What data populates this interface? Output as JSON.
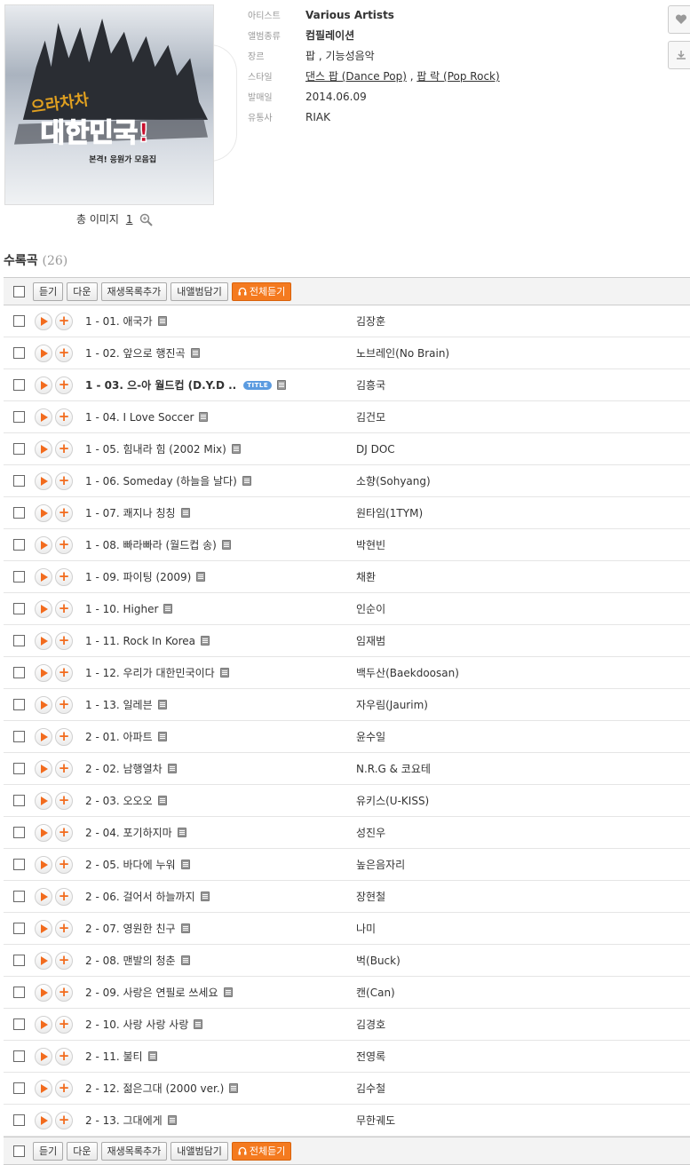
{
  "album": {
    "image_count_label": "총 이미지",
    "image_count": "1",
    "cover_text_1": "으라차차",
    "cover_text_2": "대한민국!",
    "cover_text_3": "본격! 응원가 모음집"
  },
  "info": {
    "artist_label": "아티스트",
    "artist_value": "Various Artists",
    "type_label": "앨범종류",
    "type_value": "컴필레이션",
    "genre_label": "장르",
    "genre_value": "팝 , 기능성음악",
    "style_label": "스타일",
    "style_1": "댄스 팝 (Dance Pop)",
    "style_sep": " , ",
    "style_2": "팝 락 (Pop Rock)",
    "release_label": "발매일",
    "release_value": "2014.06.09",
    "distributor_label": "유통사",
    "distributor_value": "RIAK"
  },
  "side_buttons": {
    "like_icon": "heart-icon",
    "download_icon": "download-icon"
  },
  "tracks_header": {
    "title": "수록곡",
    "count": "(26)"
  },
  "toolbar": {
    "listen": "듣기",
    "download": "다운",
    "add_playlist": "재생목록추가",
    "my_album": "내앨범담기",
    "listen_all": "전체듣기"
  },
  "tracks": [
    {
      "no": "1 - 01.",
      "title": "애국가",
      "artist": "김장훈"
    },
    {
      "no": "1 - 02.",
      "title": "앞으로 행진곡",
      "artist": "노브레인(No Brain)"
    },
    {
      "no": "1 - 03.",
      "title": "으-아 월드컵 (D.Y.D ..",
      "artist": "김흥국",
      "badge": "TITLE"
    },
    {
      "no": "1 - 04.",
      "title": "I Love Soccer",
      "artist": "김건모"
    },
    {
      "no": "1 - 05.",
      "title": "힘내라 힘 (2002 Mix)",
      "artist": "DJ DOC"
    },
    {
      "no": "1 - 06.",
      "title": "Someday (하늘을 날다)",
      "artist": "소향(Sohyang)"
    },
    {
      "no": "1 - 07.",
      "title": "쾌지나 칭칭",
      "artist": "원타임(1TYM)"
    },
    {
      "no": "1 - 08.",
      "title": "빠라빠라 (월드컵 송)",
      "artist": "박현빈"
    },
    {
      "no": "1 - 09.",
      "title": "파이팅 (2009)",
      "artist": "채환"
    },
    {
      "no": "1 - 10.",
      "title": "Higher",
      "artist": "인순이"
    },
    {
      "no": "1 - 11.",
      "title": "Rock In Korea",
      "artist": "임재범"
    },
    {
      "no": "1 - 12.",
      "title": "우리가 대한민국이다",
      "artist": "백두산(Baekdoosan)"
    },
    {
      "no": "1 - 13.",
      "title": "일레븐",
      "artist": "자우림(Jaurim)"
    },
    {
      "no": "2 - 01.",
      "title": "아파트",
      "artist": "윤수일"
    },
    {
      "no": "2 - 02.",
      "title": "남행열차",
      "artist": "N.R.G & 코요테"
    },
    {
      "no": "2 - 03.",
      "title": "오오오",
      "artist": "유키스(U-KISS)"
    },
    {
      "no": "2 - 04.",
      "title": "포기하지마",
      "artist": "성진우"
    },
    {
      "no": "2 - 05.",
      "title": "바다에 누워",
      "artist": "높은음자리"
    },
    {
      "no": "2 - 06.",
      "title": "걸어서 하늘까지",
      "artist": "장현철"
    },
    {
      "no": "2 - 07.",
      "title": "영원한 친구",
      "artist": "나미"
    },
    {
      "no": "2 - 08.",
      "title": "맨발의 청춘",
      "artist": "벅(Buck)"
    },
    {
      "no": "2 - 09.",
      "title": "사랑은 연필로 쓰세요",
      "artist": "캔(Can)"
    },
    {
      "no": "2 - 10.",
      "title": "사랑 사랑 사랑",
      "artist": "김경호"
    },
    {
      "no": "2 - 11.",
      "title": "불티",
      "artist": "전영록"
    },
    {
      "no": "2 - 12.",
      "title": "젊은그대 (2000 ver.)",
      "artist": "김수철"
    },
    {
      "no": "2 - 13.",
      "title": "그대에게",
      "artist": "무한궤도"
    }
  ]
}
